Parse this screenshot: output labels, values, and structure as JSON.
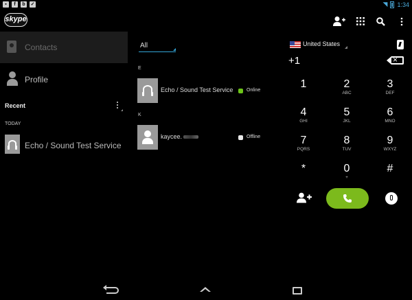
{
  "status_bar": {
    "time": "1:34",
    "notification_icons": [
      "image-icon",
      "facebook-icon",
      "bbm-icon",
      "check-icon"
    ]
  },
  "action_bar": {
    "logo_text": "skype",
    "actions": [
      "add-contact-icon",
      "dialpad-icon",
      "search-icon",
      "overflow-menu-icon"
    ]
  },
  "sidebar": {
    "contacts_label": "Contacts",
    "profile_label": "Profile",
    "recent_header": "Recent",
    "today_header": "TODAY",
    "recent_items": [
      {
        "label": "Echo / Sound Test Service",
        "icon": "headset-icon"
      }
    ]
  },
  "contacts": {
    "filter_label": "All",
    "sections": [
      {
        "letter": "E",
        "items": [
          {
            "name": "Echo / Sound Test Service",
            "status": "Online",
            "status_color": "#6cc419",
            "icon": "headset-icon"
          }
        ]
      },
      {
        "letter": "K",
        "items": [
          {
            "name": "kaycee.",
            "status": "Offline",
            "status_color": "#e8e8e8",
            "icon": "person-icon"
          }
        ]
      }
    ]
  },
  "dialer": {
    "country": "United States",
    "number": "+1",
    "keys": [
      {
        "digit": "1",
        "letters": ""
      },
      {
        "digit": "2",
        "letters": "ABC"
      },
      {
        "digit": "3",
        "letters": "DEF"
      },
      {
        "digit": "4",
        "letters": "GHI"
      },
      {
        "digit": "5",
        "letters": "JKL"
      },
      {
        "digit": "6",
        "letters": "MNO"
      },
      {
        "digit": "7",
        "letters": "PQRS"
      },
      {
        "digit": "8",
        "letters": "TUV"
      },
      {
        "digit": "9",
        "letters": "WXYZ"
      },
      {
        "digit": "*",
        "letters": ""
      },
      {
        "digit": "0",
        "letters": "+"
      },
      {
        "digit": "#",
        "letters": ""
      }
    ],
    "call_button_color": "#7cba1c"
  },
  "colors": {
    "accent_blue": "#33a6d8",
    "call_green": "#7cba1c",
    "online_green": "#6cc419"
  }
}
